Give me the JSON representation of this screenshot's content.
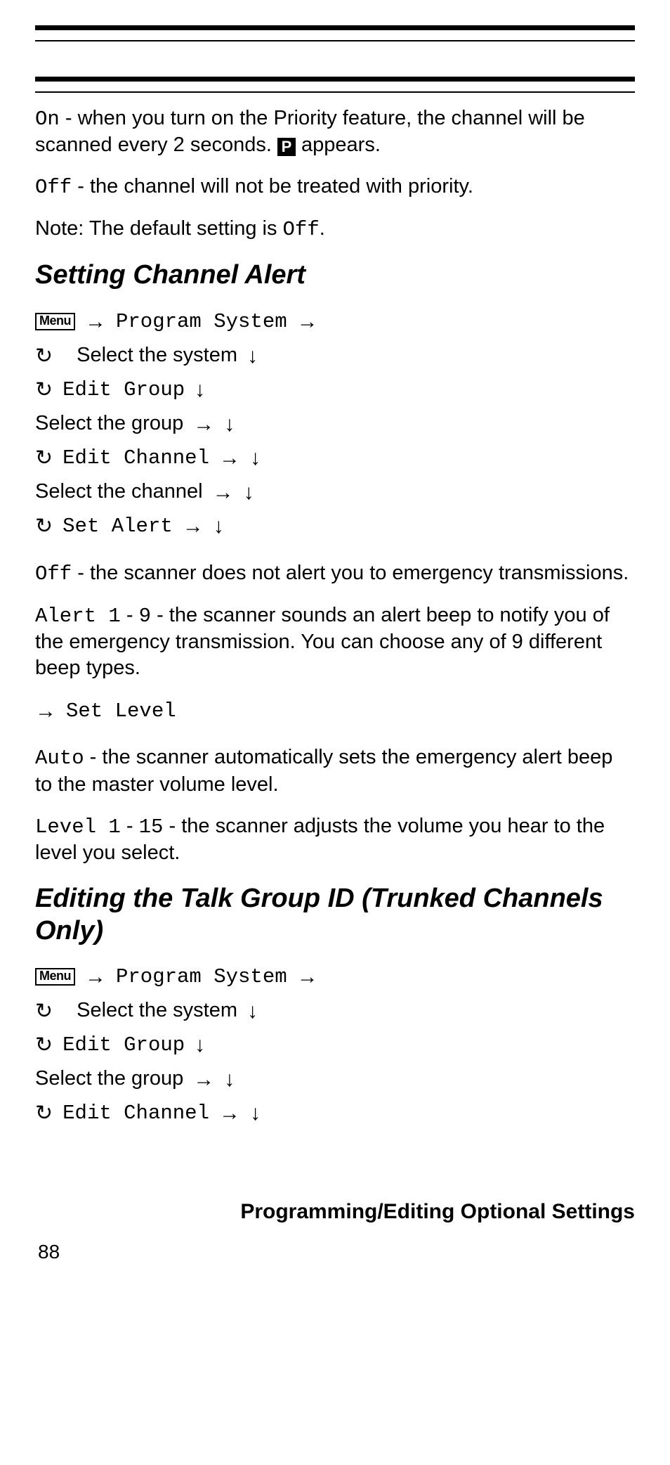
{
  "intro": {
    "on_label": "On",
    "on_text": " - when you turn on the Priority feature, the channel will be scanned every 2 seconds. ",
    "p_badge": "P",
    "on_text_tail": " appears.",
    "off_label": "Off",
    "off_text": " - the channel will not be treated with priority.",
    "note_prefix": "Note: The default setting is ",
    "note_value": "Off",
    "note_suffix": "."
  },
  "heading1": "Setting Channel Alert",
  "nav1": {
    "menu": "Menu",
    "program_system": "Program System",
    "select_system": "Select the system",
    "edit_group": "Edit Group",
    "select_group": "Select the group",
    "edit_channel": "Edit Channel",
    "select_channel": "Select the channel",
    "set_alert": "Set Alert"
  },
  "alert_defs": {
    "off_label": "Off",
    "off_text": " - the scanner does not alert you to emergency transmissions.",
    "alert_label_a": "Alert 1",
    "alert_dash": " - ",
    "alert_label_b": "9",
    "alert_text": " - the scanner sounds an alert beep to notify you of the emergency transmission. You can choose any of 9 different beep types.",
    "set_level": "Set Level",
    "auto_label": "Auto",
    "auto_text": " - the scanner automatically sets the emergency alert beep to the master volume level.",
    "level_label_a": "Level 1",
    "level_label_b": "15",
    "level_text": " - the scanner adjusts the volume you hear to the level you select."
  },
  "heading2": "Editing the Talk Group ID (Trunked Channels Only)",
  "nav2": {
    "menu": "Menu",
    "program_system": "Program System",
    "select_system": "Select the system",
    "edit_group": "Edit Group",
    "select_group": "Select the group",
    "edit_channel": "Edit Channel"
  },
  "footer": "Programming/Editing Optional Settings",
  "page_number": "88",
  "glyphs": {
    "arrow_right": "→",
    "arrow_down": "↓",
    "rotate": "↻"
  }
}
